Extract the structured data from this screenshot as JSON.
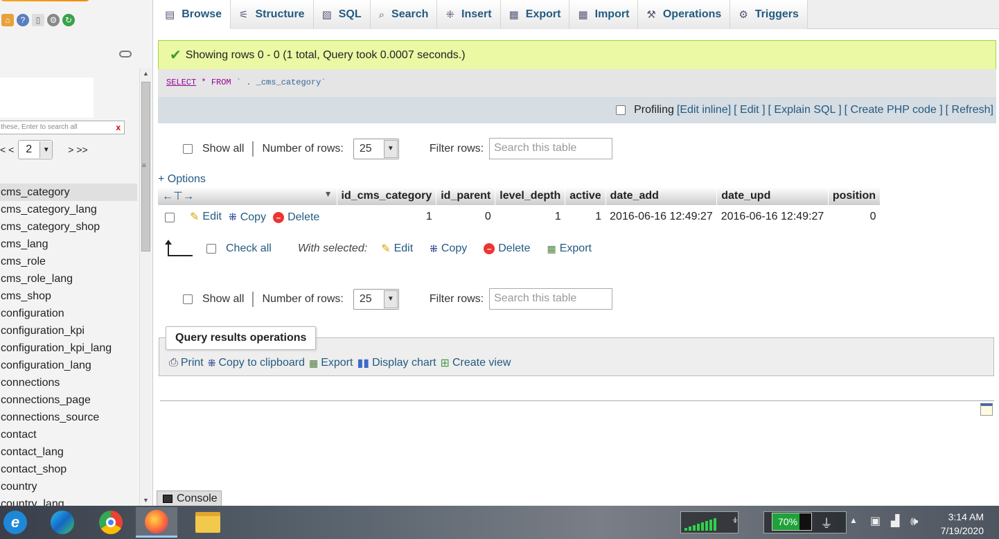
{
  "nav": {
    "filter_placeholder": "these, Enter to search all",
    "filter_clear": "x",
    "pager_prev": "< <",
    "pager_page": "2",
    "pager_next": "> >>",
    "tables": [
      "cms_category",
      "cms_category_lang",
      "cms_category_shop",
      "cms_lang",
      "cms_role",
      "cms_role_lang",
      "cms_shop",
      "configuration",
      "configuration_kpi",
      "configuration_kpi_lang",
      "configuration_lang",
      "connections",
      "connections_page",
      "connections_source",
      "contact",
      "contact_lang",
      "contact_shop",
      "country",
      "country_lang"
    ],
    "active_table": "cms_category"
  },
  "tabs": [
    {
      "label": "Browse",
      "icon": "browse-icon",
      "glyph": "▤"
    },
    {
      "label": "Structure",
      "icon": "structure-icon",
      "glyph": "⚟"
    },
    {
      "label": "SQL",
      "icon": "sql-icon",
      "glyph": "▨"
    },
    {
      "label": "Search",
      "icon": "search-icon",
      "glyph": "⌕"
    },
    {
      "label": "Insert",
      "icon": "insert-icon",
      "glyph": "⁜"
    },
    {
      "label": "Export",
      "icon": "export-icon",
      "glyph": "▦"
    },
    {
      "label": "Import",
      "icon": "import-icon",
      "glyph": "▦"
    },
    {
      "label": "Operations",
      "icon": "wrench-icon",
      "glyph": "⚒"
    },
    {
      "label": "Triggers",
      "icon": "triggers-icon",
      "glyph": "⚙"
    }
  ],
  "success": {
    "message": "Showing rows 0 - 0 (1 total, Query took 0.0007 seconds.)"
  },
  "sql": {
    "select": "SELECT",
    "star": "*",
    "from": "FROM",
    "table": "`  .  _cms_category`"
  },
  "sqltools": {
    "profiling": "Profiling",
    "links": [
      "[Edit inline]",
      "[ Edit ]",
      "[ Explain SQL ]",
      "[ Create PHP code ]",
      "[ Refresh]"
    ]
  },
  "navctl": {
    "show_all": "Show all",
    "rows_label": "Number of rows:",
    "rows_value": "25",
    "filter_label": "Filter rows:",
    "filter_placeholder": "Search this table"
  },
  "options_label": "+ Options",
  "table": {
    "headers": [
      "id_cms_category",
      "id_parent",
      "level_depth",
      "active",
      "date_add",
      "date_upd",
      "position"
    ],
    "row_actions": {
      "edit": "Edit",
      "copy": "Copy",
      "delete": "Delete"
    },
    "rows": [
      [
        "1",
        "0",
        "1",
        "1",
        "2016-06-16 12:49:27",
        "2016-06-16 12:49:27",
        "0"
      ]
    ]
  },
  "withsel": {
    "check_all": "Check all",
    "with_selected": "With selected:",
    "edit": "Edit",
    "copy": "Copy",
    "delete": "Delete",
    "export": "Export"
  },
  "qro": {
    "legend": "Query results operations",
    "print": "Print",
    "copy": "Copy to clipboard",
    "export": "Export",
    "chart": "Display chart",
    "view": "Create view"
  },
  "console": {
    "label": "Console"
  },
  "taskbar": {
    "battery": "70%",
    "battery_level": 0.7,
    "time": "3:14 AM",
    "date": "7/19/2020"
  }
}
